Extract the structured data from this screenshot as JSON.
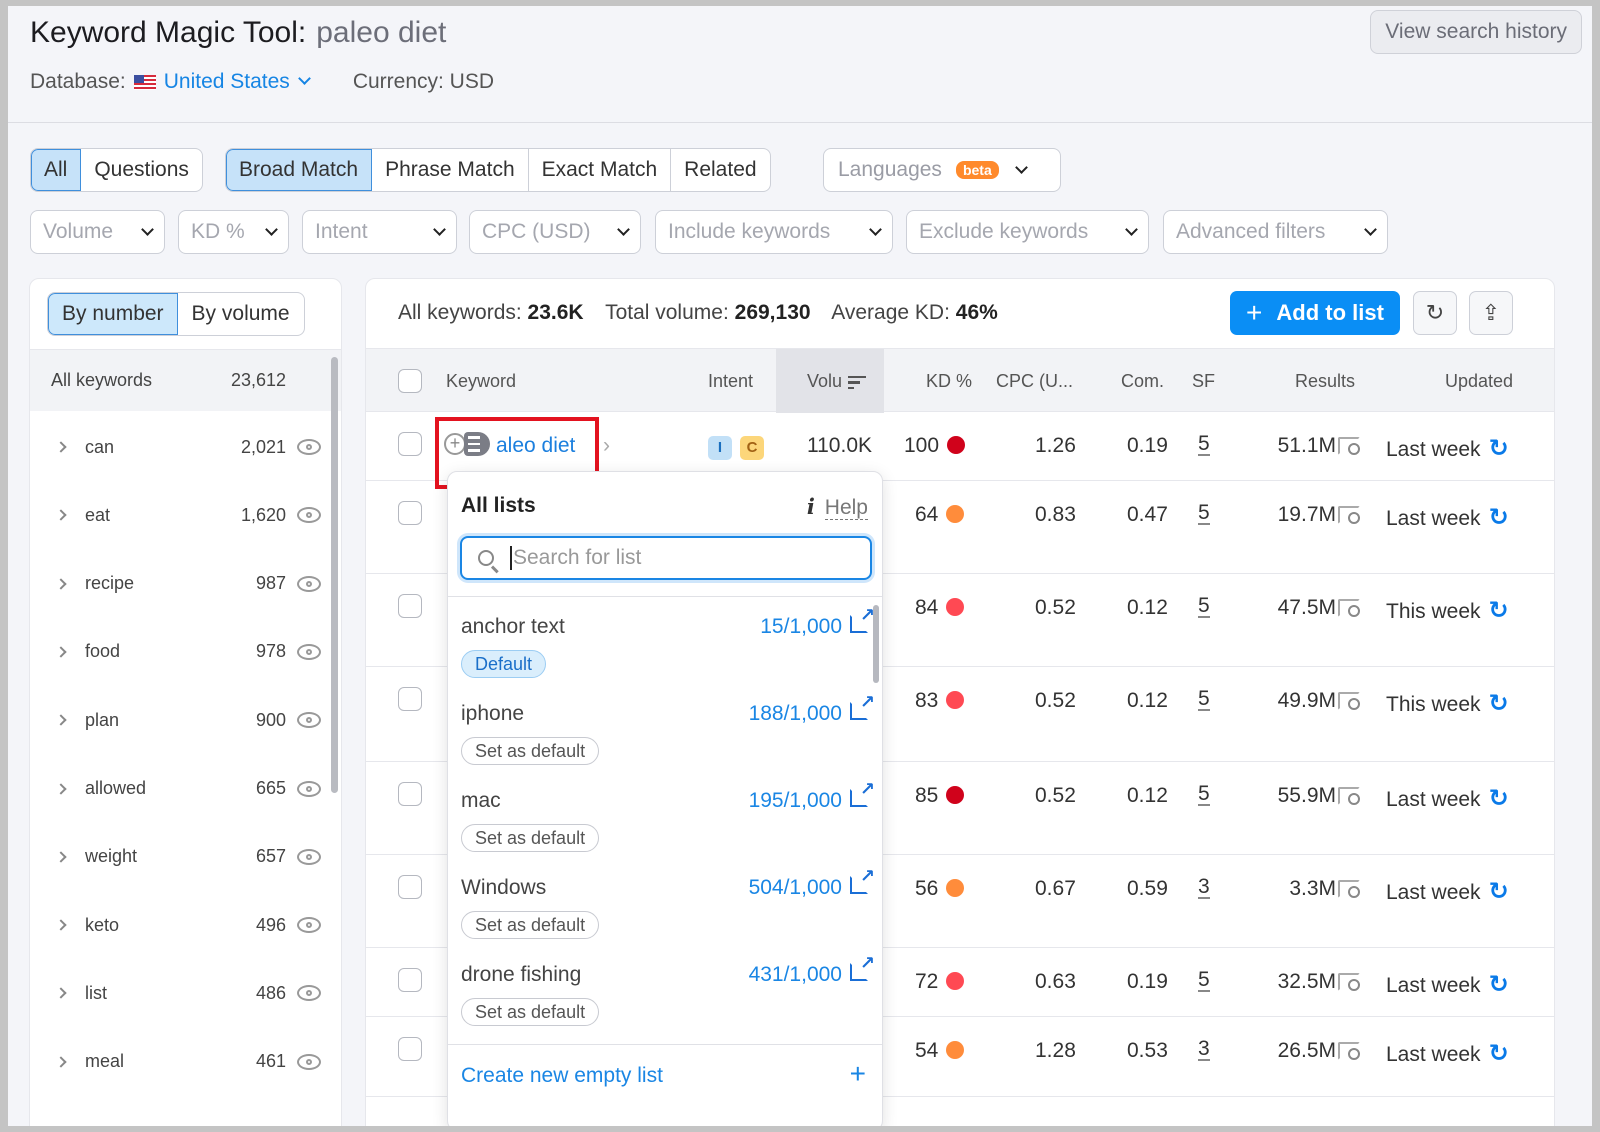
{
  "header": {
    "title": "Keyword Magic Tool:",
    "query": "paleo diet",
    "database_label": "Database:",
    "database_value": "United States",
    "currency": "Currency: USD",
    "history_button": "View search history"
  },
  "tabs_scope": [
    "All",
    "Questions"
  ],
  "tabs_match": [
    "Broad Match",
    "Phrase Match",
    "Exact Match",
    "Related"
  ],
  "languages": {
    "label": "Languages",
    "badge": "beta"
  },
  "filters": [
    "Volume",
    "KD %",
    "Intent",
    "CPC (USD)",
    "Include keywords",
    "Exclude keywords",
    "Advanced filters"
  ],
  "sidebar": {
    "toggle": [
      "By number",
      "By volume"
    ],
    "all_label": "All keywords",
    "all_count": "23,612",
    "groups": [
      {
        "name": "can",
        "count": "2,021"
      },
      {
        "name": "eat",
        "count": "1,620"
      },
      {
        "name": "recipe",
        "count": "987"
      },
      {
        "name": "food",
        "count": "978"
      },
      {
        "name": "plan",
        "count": "900"
      },
      {
        "name": "allowed",
        "count": "665"
      },
      {
        "name": "weight",
        "count": "657"
      },
      {
        "name": "keto",
        "count": "496"
      },
      {
        "name": "list",
        "count": "486"
      },
      {
        "name": "meal",
        "count": "461"
      }
    ]
  },
  "summary": {
    "all_label": "All keywords:",
    "all_value": "23.6K",
    "vol_label": "Total volume:",
    "vol_value": "269,130",
    "kd_label": "Average KD:",
    "kd_value": "46%",
    "add_button": "Add to list"
  },
  "table": {
    "headers": {
      "keyword": "Keyword",
      "intent": "Intent",
      "volume": "Volu",
      "kd": "KD %",
      "cpc": "CPC (U...",
      "com": "Com.",
      "sf": "SF",
      "results": "Results",
      "updated": "Updated"
    },
    "rows": [
      {
        "keyword": "aleo diet",
        "intents": [
          "I",
          "C"
        ],
        "volume": "110.0K",
        "kd": "100",
        "kd_color": "#d0021b",
        "cpc": "1.26",
        "com": "0.19",
        "sf": "5",
        "results": "51.1M",
        "updated": "Last week"
      },
      {
        "kd": "64",
        "kd_color": "#ff8c3b",
        "cpc": "0.83",
        "com": "0.47",
        "sf": "5",
        "results": "19.7M",
        "updated": "Last week"
      },
      {
        "kd": "84",
        "kd_color": "#ff4953",
        "cpc": "0.52",
        "com": "0.12",
        "sf": "5",
        "results": "47.5M",
        "updated": "This week"
      },
      {
        "kd": "83",
        "kd_color": "#ff4953",
        "cpc": "0.52",
        "com": "0.12",
        "sf": "5",
        "results": "49.9M",
        "updated": "This week"
      },
      {
        "kd": "85",
        "kd_color": "#d0021b",
        "cpc": "0.52",
        "com": "0.12",
        "sf": "5",
        "results": "55.9M",
        "updated": "Last week"
      },
      {
        "kd": "56",
        "kd_color": "#ff8c3b",
        "cpc": "0.67",
        "com": "0.59",
        "sf": "3",
        "results": "3.3M",
        "updated": "Last week"
      },
      {
        "kd": "72",
        "kd_color": "#ff4953",
        "cpc": "0.63",
        "com": "0.19",
        "sf": "5",
        "results": "32.5M",
        "updated": "Last week"
      },
      {
        "kd": "54",
        "kd_color": "#ff8c3b",
        "cpc": "1.28",
        "com": "0.53",
        "sf": "3",
        "results": "26.5M",
        "updated": "Last week"
      }
    ]
  },
  "dropdown": {
    "title": "All lists",
    "help": "Help",
    "search_placeholder": "Search for list",
    "lists": [
      {
        "name": "anchor text",
        "count": "15/1,000",
        "badge": "Default"
      },
      {
        "name": "iphone",
        "count": "188/1,000",
        "badge": "Set as default"
      },
      {
        "name": "mac",
        "count": "195/1,000",
        "badge": "Set as default"
      },
      {
        "name": "Windows",
        "count": "504/1,000",
        "badge": "Set as default"
      },
      {
        "name": "drone fishing",
        "count": "431/1,000",
        "badge": "Set as default"
      }
    ],
    "create": "Create new empty list"
  }
}
